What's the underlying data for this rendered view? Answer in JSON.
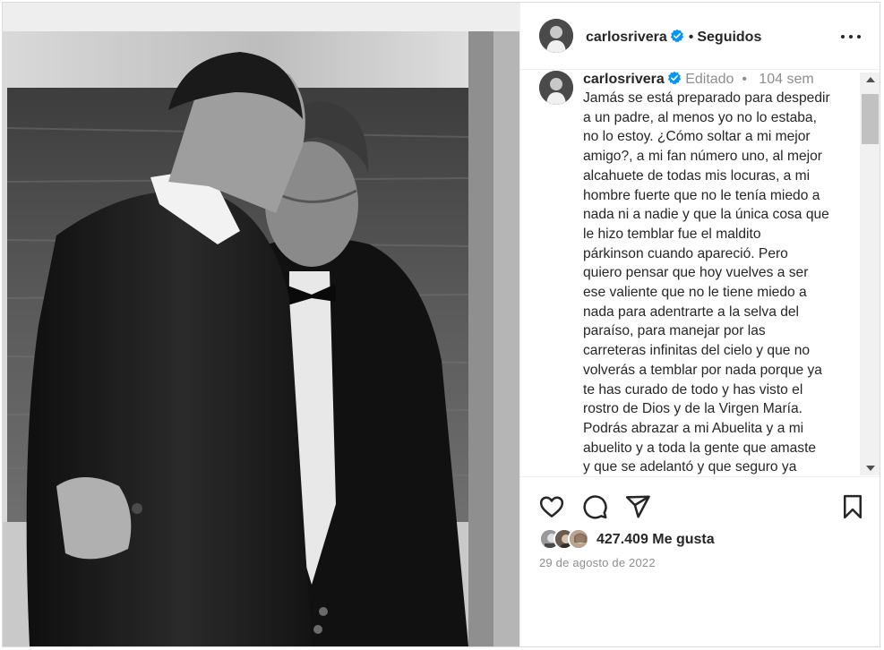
{
  "post": {
    "username": "carlosrivera",
    "follow_status": "Seguidos",
    "separator": "•",
    "edited_label": "Editado",
    "time_ago": "104 sem",
    "caption": "Jamás se está preparado para despedir\na un padre, al menos yo no lo estaba,\nno lo estoy. ¿Cómo soltar a mi mejor\namigo?, a mi fan número uno, al mejor\nalcahuete de todas mis locuras, a mi\nhombre fuerte que no le tenía miedo a\nnada ni a nadie y que la única cosa que\nle hizo temblar fue el maldito\npárkinson cuando apareció. Pero\nquiero pensar que hoy vuelves a ser\nese valiente que no le tiene miedo a\nnada para adentrarte a la selva del\nparaíso, para manejar por las\ncarreteras infinitas del cielo y que no\nvolverás a temblar por nada porque ya\nte has curado de todo y has visto el\nrostro de Dios y de la Virgen María.\nPodrás abrazar a mi Abuelita y a mi\nabuelito y a toda la gente que amaste\ny que se adelantó y que seguro ya\nestaba esperándote con una fiesta",
    "likes": "427.409",
    "likes_label": "Me gusta",
    "date": "29 de agosto de 2022"
  },
  "icons": {
    "verified": "verified-badge-icon",
    "more": "more-options-icon",
    "like": "heart-icon",
    "comment": "comment-icon",
    "share": "paper-plane-icon",
    "save": "bookmark-icon"
  },
  "colors": {
    "verified_blue": "#0095f6",
    "text": "#262626",
    "secondary_text": "#8e8e8e",
    "border": "#dbdbdb"
  }
}
